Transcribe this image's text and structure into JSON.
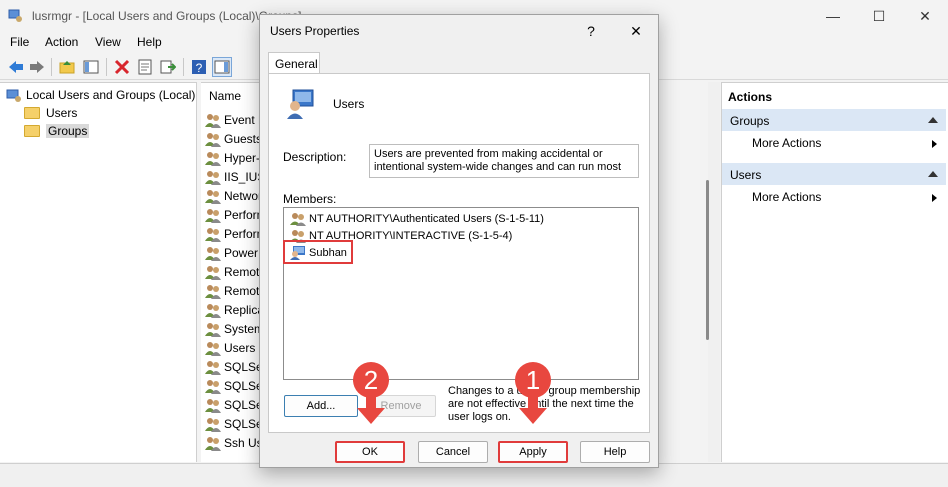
{
  "window": {
    "title": "lusrmgr - [Local Users and Groups (Local)\\Groups]",
    "minimize": "—",
    "maximize": "☐",
    "close": "✕"
  },
  "menu": [
    "File",
    "Action",
    "View",
    "Help"
  ],
  "tree": {
    "root": "Local Users and Groups (Local)",
    "items": [
      "Users",
      "Groups"
    ]
  },
  "list": {
    "header": "Name",
    "rows": [
      "Event L",
      "Guests",
      "Hyper-",
      "IIS_IUSR",
      "Networ",
      "Perform",
      "Perform",
      "Power",
      "Remote",
      "Remote",
      "Replica",
      "System",
      "Users",
      "SQLSer",
      "SQLSer",
      "SQLSer",
      "SQLSer",
      "Ssh Use"
    ]
  },
  "actions": {
    "header": "Actions",
    "sections": [
      {
        "title": "Groups",
        "item": "More Actions"
      },
      {
        "title": "Users",
        "item": "More Actions"
      }
    ]
  },
  "dialog": {
    "title": "Users Properties",
    "help": "?",
    "close": "✕",
    "tab": "General",
    "group_name": "Users",
    "description_label": "Description:",
    "description": "Users are prevented from making accidental or intentional system-wide changes and can run most",
    "members_label": "Members:",
    "members": [
      "NT AUTHORITY\\Authenticated Users (S-1-5-11)",
      "NT AUTHORITY\\INTERACTIVE (S-1-5-4)",
      "Subhan"
    ],
    "add_label": "Add...",
    "remove_label": "Remove",
    "note": "Changes to a user's group membership are not effective until the next time the user logs on.",
    "ok_label": "OK",
    "cancel_label": "Cancel",
    "apply_label": "Apply",
    "help_label": "Help"
  },
  "callouts": {
    "first": "1",
    "second": "2"
  },
  "colors": {
    "highlight": "#e03b3b",
    "callout": "#e8473f",
    "action_section": "#dbe7f5"
  }
}
